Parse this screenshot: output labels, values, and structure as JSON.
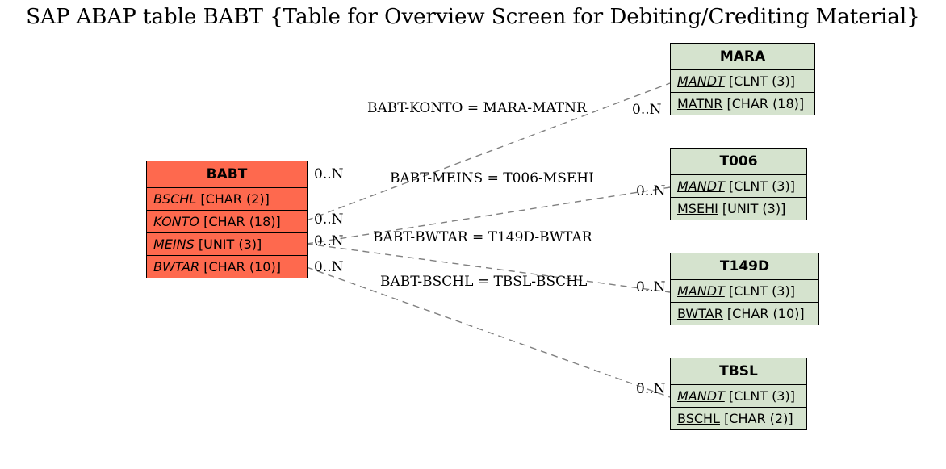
{
  "title": "SAP ABAP table BABT {Table for Overview Screen for Debiting/Crediting Material}",
  "entities": {
    "babt": {
      "name": "BABT",
      "fields": [
        {
          "label": "BSCHL",
          "type": "[CHAR (2)]"
        },
        {
          "label": "KONTO",
          "type": "[CHAR (18)]"
        },
        {
          "label": "MEINS",
          "type": "[UNIT (3)]"
        },
        {
          "label": "BWTAR",
          "type": "[CHAR (10)]"
        }
      ]
    },
    "mara": {
      "name": "MARA",
      "fields": [
        {
          "label": "MANDT",
          "type": "[CLNT (3)]"
        },
        {
          "label": "MATNR",
          "type": "[CHAR (18)]"
        }
      ]
    },
    "t006": {
      "name": "T006",
      "fields": [
        {
          "label": "MANDT",
          "type": "[CLNT (3)]"
        },
        {
          "label": "MSEHI",
          "type": "[UNIT (3)]"
        }
      ]
    },
    "t149d": {
      "name": "T149D",
      "fields": [
        {
          "label": "MANDT",
          "type": "[CLNT (3)]"
        },
        {
          "label": "BWTAR",
          "type": "[CHAR (10)]"
        }
      ]
    },
    "tbsl": {
      "name": "TBSL",
      "fields": [
        {
          "label": "MANDT",
          "type": "[CLNT (3)]"
        },
        {
          "label": "BSCHL",
          "type": "[CHAR (2)]"
        }
      ]
    }
  },
  "relations": {
    "r1": {
      "text": "BABT-KONTO = MARA-MATNR",
      "left_card": "0..N",
      "right_card": "0..N"
    },
    "r2": {
      "text": "BABT-MEINS = T006-MSEHI",
      "left_card": "0..N",
      "right_card": "0..N"
    },
    "r3": {
      "text": "BABT-BWTAR = T149D-BWTAR",
      "left_card": "0..N",
      "right_card": "0..N"
    },
    "r4": {
      "text": "BABT-BSCHL = TBSL-BSCHL",
      "left_card": "0..N",
      "right_card": "0..N"
    }
  }
}
